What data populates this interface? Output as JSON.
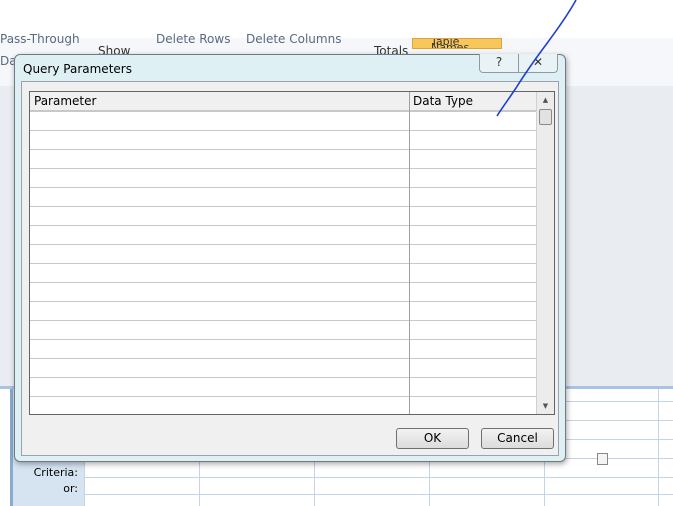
{
  "ribbon": {
    "pass_through": "Pass-Through",
    "data_definition": "Data",
    "show": "Show",
    "delete_rows": "Delete Rows",
    "delete_columns": "Delete Columns",
    "totals": "Totals",
    "table_names": "Table Names"
  },
  "query_grid": {
    "criteria_label": "Criteria:",
    "or_label": "or:"
  },
  "dialog": {
    "title": "Query Parameters",
    "help_glyph": "?",
    "close_glyph": "✕",
    "columns": [
      "Parameter",
      "Data Type"
    ],
    "rows": [
      [
        "",
        ""
      ],
      [
        "",
        ""
      ],
      [
        "",
        ""
      ],
      [
        "",
        ""
      ],
      [
        "",
        ""
      ],
      [
        "",
        ""
      ],
      [
        "",
        ""
      ],
      [
        "",
        ""
      ],
      [
        "",
        ""
      ],
      [
        "",
        ""
      ],
      [
        "",
        ""
      ],
      [
        "",
        ""
      ],
      [
        "",
        ""
      ],
      [
        "",
        ""
      ],
      [
        "",
        ""
      ],
      [
        "",
        ""
      ]
    ],
    "ok_label": "OK",
    "cancel_label": "Cancel"
  },
  "colors": {
    "pen": "#1f3fd0",
    "table_names_bg": "#f8c65a"
  }
}
